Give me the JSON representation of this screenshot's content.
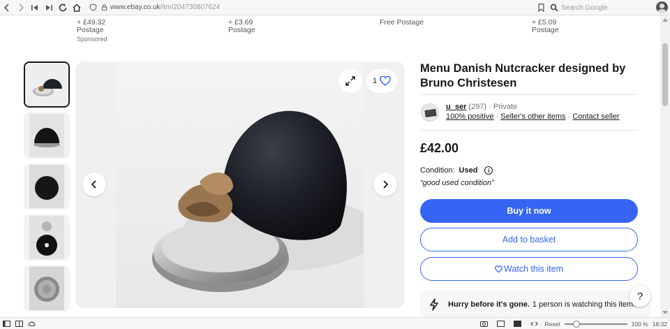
{
  "browser": {
    "url_host": "www.ebay.co.uk",
    "url_path": "/itm/204730807624",
    "search_placeholder": "Search Google"
  },
  "related_items": [
    {
      "price": "+ £49.32",
      "postage": "Postage",
      "sponsored": "Sponsored"
    },
    {
      "price": "+ £3.69",
      "postage": "Postage"
    },
    {
      "price": "Free Postage",
      "postage": ""
    },
    {
      "price": "+ £5.09",
      "postage": "Postage"
    }
  ],
  "gallery": {
    "watch_count": "1",
    "thumbnails": [
      "thumb-1",
      "thumb-2",
      "thumb-3",
      "thumb-4",
      "thumb-5"
    ]
  },
  "listing": {
    "title": "Menu Danish Nutcracker designed by Bruno Christesen",
    "seller": {
      "name": "u_ser",
      "feedback_count": "(297)",
      "separator": "·",
      "type": "Private",
      "positive": "100% positive",
      "other_items": "Seller's other items",
      "contact": "Contact seller"
    },
    "price": "£42.00",
    "condition_label": "Condition:",
    "condition_value": "Used",
    "condition_note": "“good used condition”",
    "buy_now": "Buy it now",
    "add_to_basket": "Add to basket",
    "watch_item": "Watch this item",
    "urgency_bold": "Hurry before it's gone.",
    "urgency_text": "1 person is watching this item.",
    "help": "?"
  },
  "statusbar": {
    "reset": "Reset",
    "zoom": "100 %",
    "time": "18:32"
  },
  "colors": {
    "ebay_blue": "#3665f3",
    "text": "#191919",
    "muted": "#707070"
  }
}
